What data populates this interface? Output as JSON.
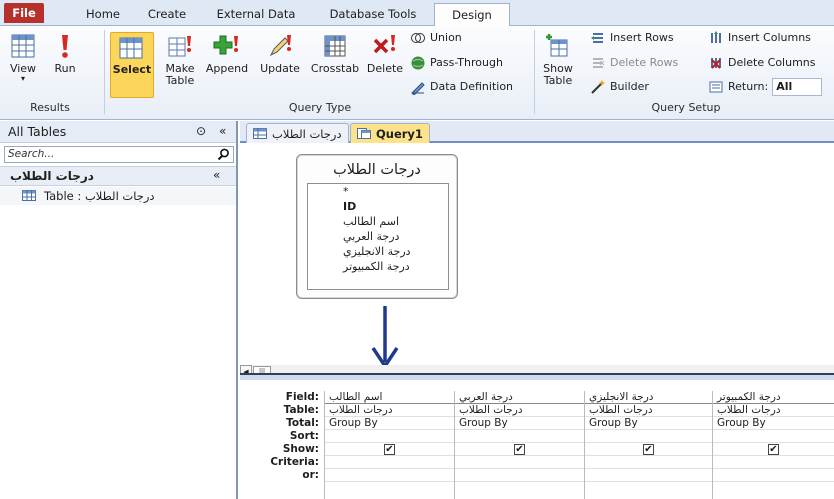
{
  "tabs": [
    "File",
    "Home",
    "Create",
    "External Data",
    "Database Tools",
    "Design"
  ],
  "active_tab": "Design",
  "ribbon": {
    "results": {
      "label": "Results",
      "view": "View",
      "run": "Run"
    },
    "query_type": {
      "label": "Query Type",
      "select": "Select",
      "make_table": [
        "Make",
        "Table"
      ],
      "append": "Append",
      "update": "Update",
      "crosstab": "Crosstab",
      "delete": "Delete",
      "union": "Union",
      "pass_through": "Pass-Through",
      "data_definition": "Data Definition"
    },
    "query_setup": {
      "label": "Query Setup",
      "show_table": [
        "Show",
        "Table"
      ],
      "insert_rows": "Insert Rows",
      "delete_rows": "Delete Rows",
      "builder": "Builder",
      "insert_columns": "Insert Columns",
      "delete_columns": "Delete Columns",
      "return_label": "Return:",
      "return_value": "All"
    }
  },
  "nav": {
    "title": "All Tables",
    "search_placeholder": "Search...",
    "group": "درجات الطلاب",
    "item": "Table : درجات الطلاب"
  },
  "doc_tabs": [
    "درجات الطلاب",
    "Query1"
  ],
  "field_list": {
    "title": "درجات الطلاب",
    "fields": [
      "*",
      "ID",
      "اسم الطالب",
      "درجة العربي",
      "درجة الانجليزي",
      "درجة الكمبيوتر"
    ]
  },
  "grid": {
    "row_labels": [
      "Field:",
      "Table:",
      "Total:",
      "Sort:",
      "Show:",
      "Criteria:",
      "or:"
    ],
    "columns": [
      {
        "field": "اسم الطالب",
        "table": "درجات الطلاب",
        "total": "Group By",
        "show": "✔"
      },
      {
        "field": "درجة العربي",
        "table": "درجات الطلاب",
        "total": "Group By",
        "show": "✔"
      },
      {
        "field": "درجة الانجليزي",
        "table": "درجات الطلاب",
        "total": "Group By",
        "show": "✔"
      },
      {
        "field": "درجة الكمبيوتر",
        "table": "درجات الطلاب",
        "total": "Group By",
        "show": "✔"
      }
    ]
  },
  "colors": {
    "file_tab": "#b7312c",
    "selected_button": "#fbd65a",
    "arrow": "#1f3a8a"
  }
}
